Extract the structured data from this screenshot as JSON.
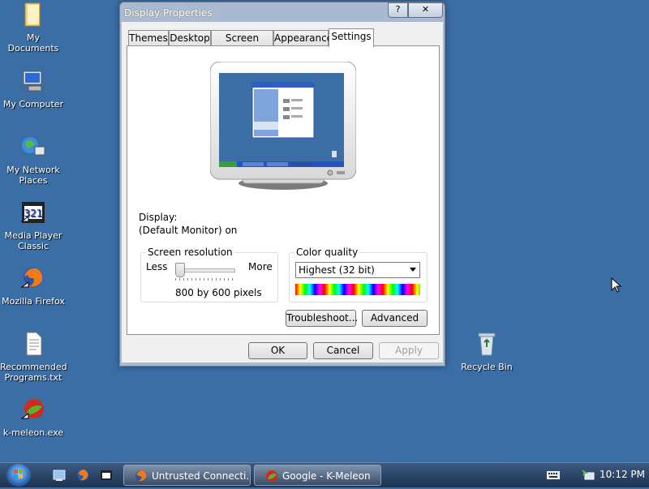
{
  "desktop": {
    "icons": [
      {
        "label": "My Documents",
        "icon": "folder-icon"
      },
      {
        "label": "My Computer",
        "icon": "computer-icon"
      },
      {
        "label": "My Network Places",
        "icon": "network-icon"
      },
      {
        "label": "Media Player Classic",
        "icon": "media-player-icon"
      },
      {
        "label": "Mozilla Firefox",
        "icon": "firefox-icon"
      },
      {
        "label": "Recommended Programs.txt",
        "icon": "text-file-icon"
      },
      {
        "label": "k-meleon.exe",
        "icon": "kmeleon-icon"
      },
      {
        "label": "Recycle Bin",
        "icon": "recycle-bin-icon"
      }
    ]
  },
  "window": {
    "title": "Display Properties",
    "help_label": "?",
    "close_label": "✕",
    "tabs": [
      "Themes",
      "Desktop",
      "Screen Saver",
      "Appearance",
      "Settings"
    ],
    "active_tab": "Settings",
    "display_label": "Display:",
    "display_value": "(Default Monitor) on",
    "resolution": {
      "group_label": "Screen resolution",
      "less_label": "Less",
      "more_label": "More",
      "value_text": "800 by 600 pixels",
      "slider_level": 0
    },
    "color": {
      "group_label": "Color quality",
      "selected": "Highest (32 bit)"
    },
    "troubleshoot_label": "Troubleshoot...",
    "advanced_label": "Advanced",
    "ok_label": "OK",
    "cancel_label": "Cancel",
    "apply_label": "Apply"
  },
  "taskbar": {
    "tasks": [
      {
        "label": "Untrusted Connecti...",
        "icon": "firefox-icon"
      },
      {
        "label": "Google - K-Meleon",
        "icon": "kmeleon-icon"
      }
    ],
    "clock": "10:12 PM"
  }
}
